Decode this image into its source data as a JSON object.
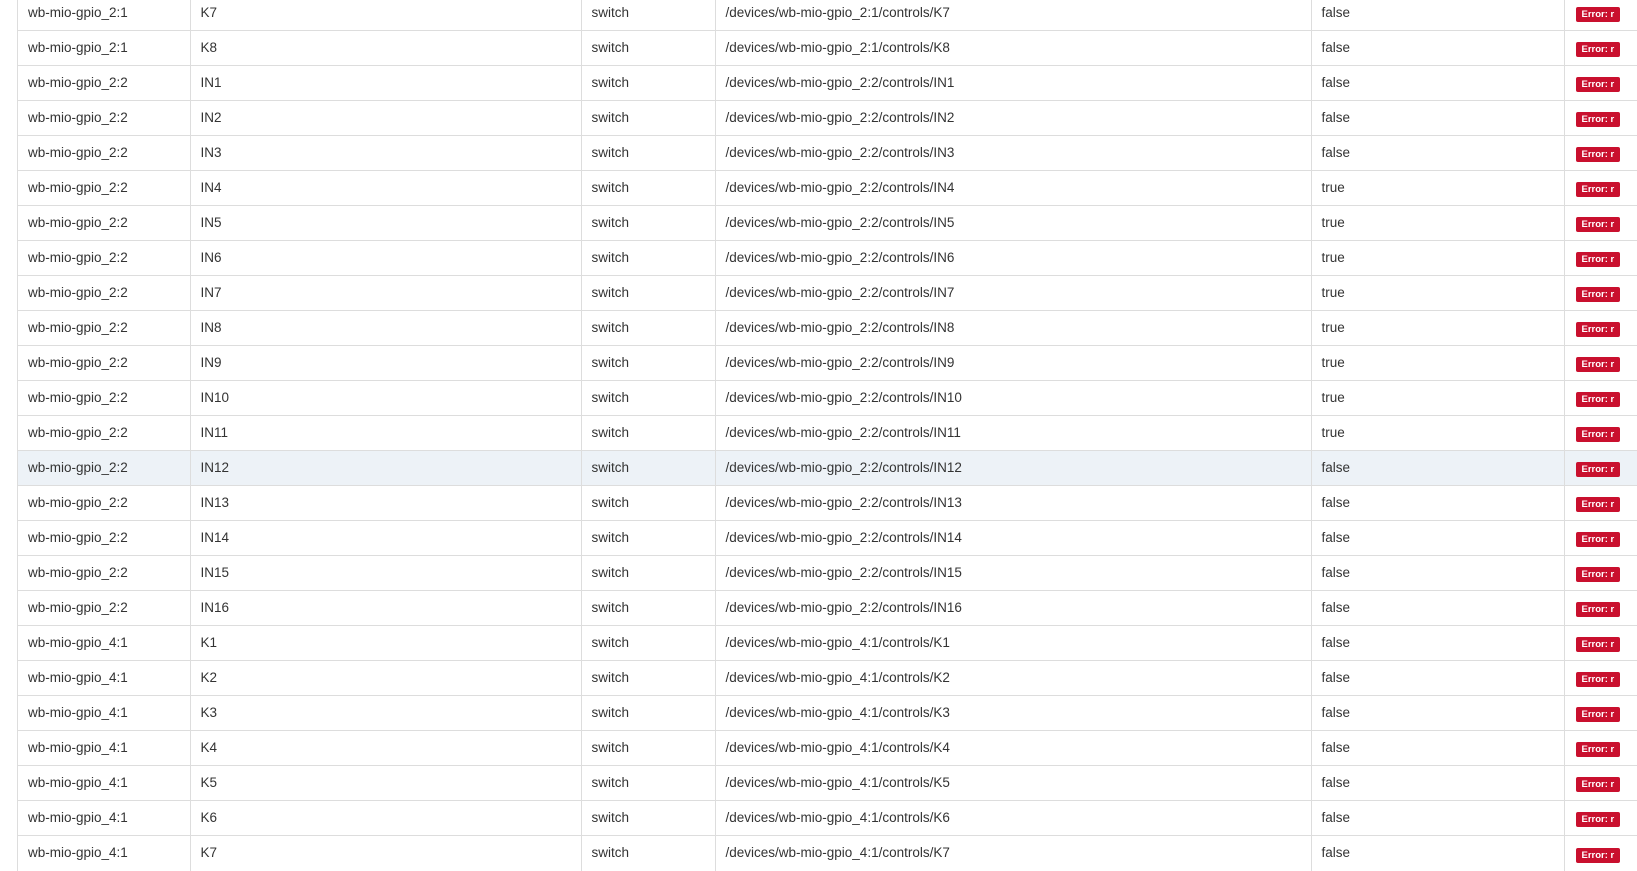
{
  "error_label": "Error: r",
  "colors": {
    "row_highlight": "#edf2f7",
    "error_badge": "#c9102e",
    "grid_line": "#dddddd"
  },
  "rows": [
    {
      "device": "wb-mio-gpio_2:1",
      "control": "K7",
      "type": "switch",
      "topic": "/devices/wb-mio-gpio_2:1/controls/K7",
      "value": "false"
    },
    {
      "device": "wb-mio-gpio_2:1",
      "control": "K8",
      "type": "switch",
      "topic": "/devices/wb-mio-gpio_2:1/controls/K8",
      "value": "false"
    },
    {
      "device": "wb-mio-gpio_2:2",
      "control": "IN1",
      "type": "switch",
      "topic": "/devices/wb-mio-gpio_2:2/controls/IN1",
      "value": "false"
    },
    {
      "device": "wb-mio-gpio_2:2",
      "control": "IN2",
      "type": "switch",
      "topic": "/devices/wb-mio-gpio_2:2/controls/IN2",
      "value": "false"
    },
    {
      "device": "wb-mio-gpio_2:2",
      "control": "IN3",
      "type": "switch",
      "topic": "/devices/wb-mio-gpio_2:2/controls/IN3",
      "value": "false"
    },
    {
      "device": "wb-mio-gpio_2:2",
      "control": "IN4",
      "type": "switch",
      "topic": "/devices/wb-mio-gpio_2:2/controls/IN4",
      "value": "true"
    },
    {
      "device": "wb-mio-gpio_2:2",
      "control": "IN5",
      "type": "switch",
      "topic": "/devices/wb-mio-gpio_2:2/controls/IN5",
      "value": "true"
    },
    {
      "device": "wb-mio-gpio_2:2",
      "control": "IN6",
      "type": "switch",
      "topic": "/devices/wb-mio-gpio_2:2/controls/IN6",
      "value": "true"
    },
    {
      "device": "wb-mio-gpio_2:2",
      "control": "IN7",
      "type": "switch",
      "topic": "/devices/wb-mio-gpio_2:2/controls/IN7",
      "value": "true"
    },
    {
      "device": "wb-mio-gpio_2:2",
      "control": "IN8",
      "type": "switch",
      "topic": "/devices/wb-mio-gpio_2:2/controls/IN8",
      "value": "true"
    },
    {
      "device": "wb-mio-gpio_2:2",
      "control": "IN9",
      "type": "switch",
      "topic": "/devices/wb-mio-gpio_2:2/controls/IN9",
      "value": "true"
    },
    {
      "device": "wb-mio-gpio_2:2",
      "control": "IN10",
      "type": "switch",
      "topic": "/devices/wb-mio-gpio_2:2/controls/IN10",
      "value": "true"
    },
    {
      "device": "wb-mio-gpio_2:2",
      "control": "IN11",
      "type": "switch",
      "topic": "/devices/wb-mio-gpio_2:2/controls/IN11",
      "value": "true"
    },
    {
      "device": "wb-mio-gpio_2:2",
      "control": "IN12",
      "type": "switch",
      "topic": "/devices/wb-mio-gpio_2:2/controls/IN12",
      "value": "false",
      "highlighted": true
    },
    {
      "device": "wb-mio-gpio_2:2",
      "control": "IN13",
      "type": "switch",
      "topic": "/devices/wb-mio-gpio_2:2/controls/IN13",
      "value": "false"
    },
    {
      "device": "wb-mio-gpio_2:2",
      "control": "IN14",
      "type": "switch",
      "topic": "/devices/wb-mio-gpio_2:2/controls/IN14",
      "value": "false"
    },
    {
      "device": "wb-mio-gpio_2:2",
      "control": "IN15",
      "type": "switch",
      "topic": "/devices/wb-mio-gpio_2:2/controls/IN15",
      "value": "false"
    },
    {
      "device": "wb-mio-gpio_2:2",
      "control": "IN16",
      "type": "switch",
      "topic": "/devices/wb-mio-gpio_2:2/controls/IN16",
      "value": "false"
    },
    {
      "device": "wb-mio-gpio_4:1",
      "control": "K1",
      "type": "switch",
      "topic": "/devices/wb-mio-gpio_4:1/controls/K1",
      "value": "false"
    },
    {
      "device": "wb-mio-gpio_4:1",
      "control": "K2",
      "type": "switch",
      "topic": "/devices/wb-mio-gpio_4:1/controls/K2",
      "value": "false"
    },
    {
      "device": "wb-mio-gpio_4:1",
      "control": "K3",
      "type": "switch",
      "topic": "/devices/wb-mio-gpio_4:1/controls/K3",
      "value": "false"
    },
    {
      "device": "wb-mio-gpio_4:1",
      "control": "K4",
      "type": "switch",
      "topic": "/devices/wb-mio-gpio_4:1/controls/K4",
      "value": "false"
    },
    {
      "device": "wb-mio-gpio_4:1",
      "control": "K5",
      "type": "switch",
      "topic": "/devices/wb-mio-gpio_4:1/controls/K5",
      "value": "false"
    },
    {
      "device": "wb-mio-gpio_4:1",
      "control": "K6",
      "type": "switch",
      "topic": "/devices/wb-mio-gpio_4:1/controls/K6",
      "value": "false"
    },
    {
      "device": "wb-mio-gpio_4:1",
      "control": "K7",
      "type": "switch",
      "topic": "/devices/wb-mio-gpio_4:1/controls/K7",
      "value": "false"
    }
  ]
}
